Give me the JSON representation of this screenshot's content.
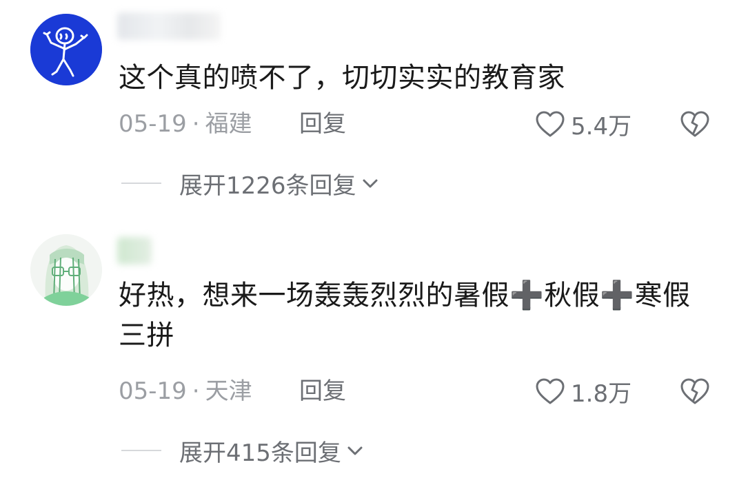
{
  "comments": [
    {
      "text": "这个真的喷不了，切切实实的教育家",
      "date": "05-19",
      "separator": "·",
      "location": "福建",
      "reply_label": "回复",
      "likes": "5.4万",
      "expand_label": "展开1226条回复"
    },
    {
      "text": "好热，想来一场轰轰烈烈的暑假➕秋假➕寒假三拼",
      "date": "05-19",
      "separator": "·",
      "location": "天津",
      "reply_label": "回复",
      "likes": "1.8万",
      "expand_label": "展开415条回复"
    }
  ],
  "icons": {
    "like": "heart-outline-icon",
    "dislike": "broken-heart-icon",
    "expand": "chevron-down-icon"
  },
  "colors": {
    "text": "#1a1a1a",
    "meta": "#9b9ea3",
    "action": "#6c6f74",
    "avatar1_bg": "#1a3ad6"
  }
}
